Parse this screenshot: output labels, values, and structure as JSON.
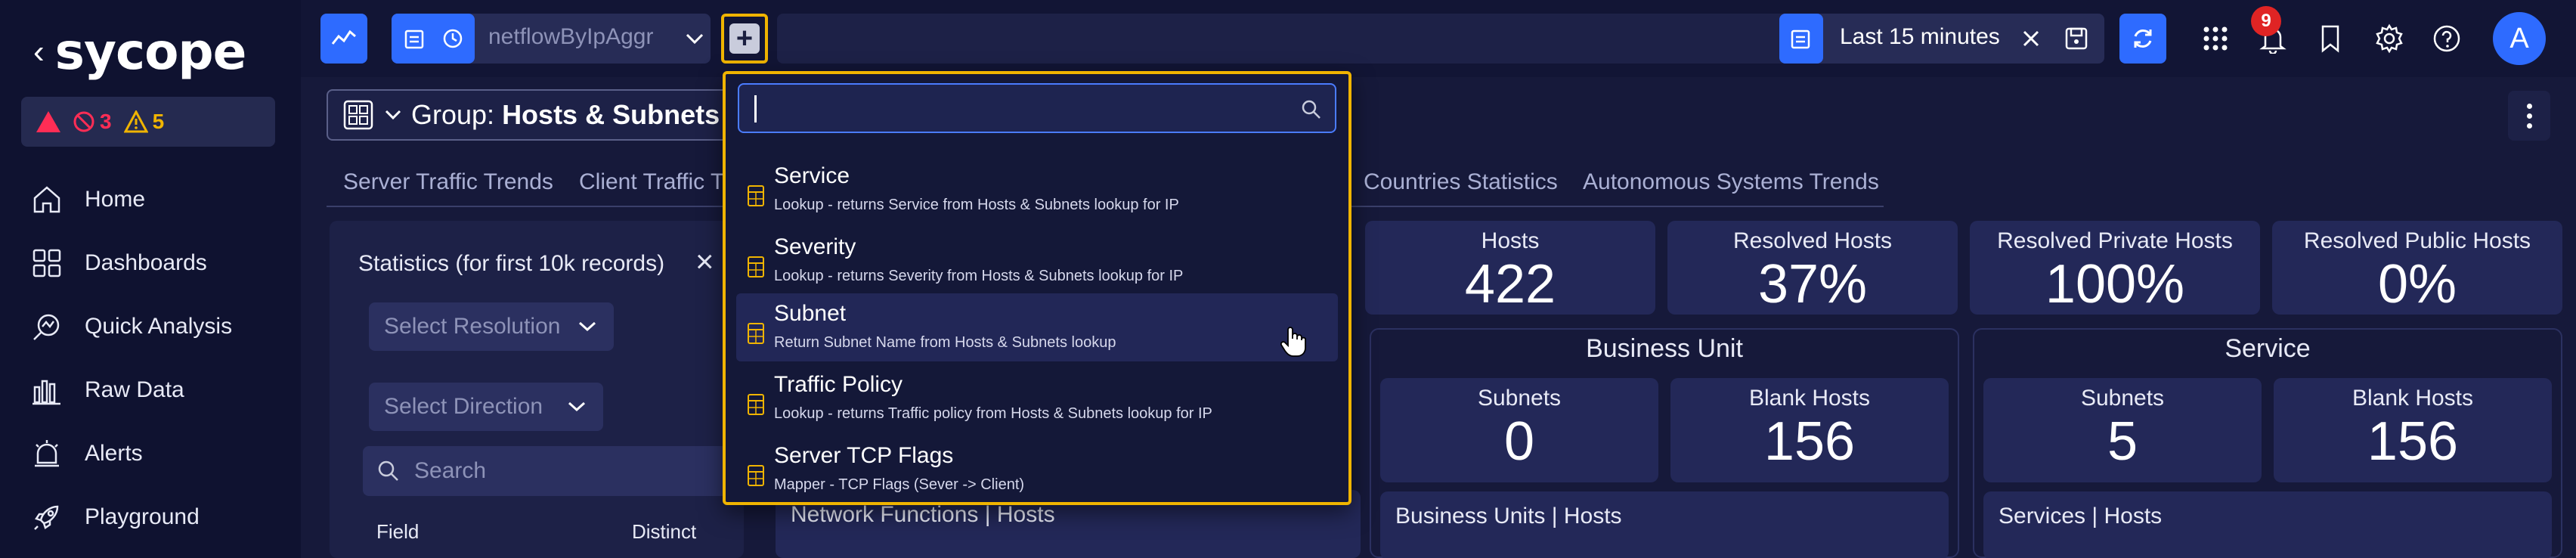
{
  "brand": {
    "logo_text": "sycope",
    "accent": "#2e6bff",
    "highlight": "#f0b400"
  },
  "sidebar": {
    "alerts": {
      "critical": "",
      "errors": "3",
      "warnings": "5"
    },
    "items": [
      {
        "label": "Home",
        "icon": "home-icon"
      },
      {
        "label": "Dashboards",
        "icon": "dashboards-icon"
      },
      {
        "label": "Quick Analysis",
        "icon": "quick-analysis-icon"
      },
      {
        "label": "Raw Data",
        "icon": "raw-data-icon"
      },
      {
        "label": "Alerts",
        "icon": "alerts-icon"
      },
      {
        "label": "Playground",
        "icon": "rocket-icon"
      }
    ]
  },
  "topbar": {
    "source": "netflowByIpAggr",
    "time_range": "Last 15 minutes",
    "notification_count": "9",
    "avatar_letter": "A"
  },
  "group": {
    "prefix": "Group: ",
    "name": "Hosts & Subnets T"
  },
  "tabs": [
    "Server Traffic Trends",
    "Client Traffic T",
    "Countries Statistics",
    "Autonomous Systems Trends"
  ],
  "stats": {
    "title": "Statistics (for first 10k records)",
    "resolution_placeholder": "Select Resolution",
    "direction_placeholder": "Select Direction",
    "search_placeholder": "Search",
    "col_field": "Field",
    "col_distinct": "Distinct"
  },
  "widgets": {
    "hosts": {
      "label": "Hosts",
      "value": "422"
    },
    "resolved_hosts": {
      "label": "Resolved Hosts",
      "value": "37%"
    },
    "resolved_private": {
      "label": "Resolved Private Hosts",
      "value": "100%"
    },
    "resolved_public": {
      "label": "Resolved Public Hosts",
      "value": "0%"
    }
  },
  "groups": {
    "business_unit": {
      "title": "Business Unit",
      "subnets": {
        "label": "Subnets",
        "value": "0"
      },
      "blank_hosts": {
        "label": "Blank Hosts",
        "value": "156"
      },
      "list_title": "Business Units | Hosts"
    },
    "service": {
      "title": "Service",
      "subnets": {
        "label": "Subnets",
        "value": "5"
      },
      "blank_hosts": {
        "label": "Blank Hosts",
        "value": "156"
      },
      "list_title": "Services | Hosts"
    },
    "network_functions": {
      "list_title": "Network Functions | Hosts"
    }
  },
  "dropdown": {
    "search_value": "",
    "items": [
      {
        "name": "Service",
        "desc": "Lookup - returns Service from Hosts & Subnets lookup for IP"
      },
      {
        "name": "Severity",
        "desc": "Lookup - returns Severity from Hosts & Subnets lookup for IP"
      },
      {
        "name": "Subnet",
        "desc": "Return Subnet Name from Hosts & Subnets lookup"
      },
      {
        "name": "Traffic Policy",
        "desc": "Lookup - returns Traffic policy from Hosts & Subnets lookup for IP"
      },
      {
        "name": "Server TCP Flags",
        "desc": "Mapper - TCP Flags (Sever -> Client)"
      }
    ]
  }
}
